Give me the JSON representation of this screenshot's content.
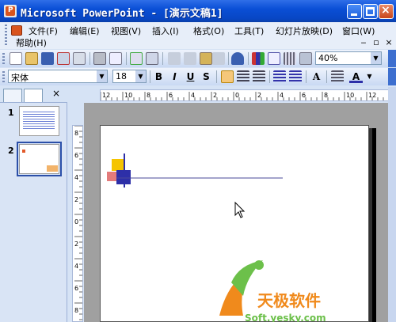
{
  "window": {
    "title": "Microsoft PowerPoint - [演示文稿1]",
    "app_icon_letter": "P"
  },
  "menu": {
    "items": [
      {
        "label": "文件(F)"
      },
      {
        "label": "编辑(E)"
      },
      {
        "label": "视图(V)"
      },
      {
        "label": "插入(I)"
      },
      {
        "label": "格式(O)"
      },
      {
        "label": "工具(T)"
      },
      {
        "label": "幻灯片放映(D)"
      },
      {
        "label": "窗口(W)"
      },
      {
        "label": "帮助(H)"
      }
    ],
    "mdi_controls": [
      "‒",
      "▫",
      "×"
    ]
  },
  "toolbar_standard": {
    "zoom": "40%"
  },
  "toolbar_format": {
    "font": "宋体",
    "size": "18",
    "bold": "B",
    "italic": "I",
    "underline": "U",
    "shadow": "S",
    "grow_font": "A",
    "font_color": "A"
  },
  "slides_panel": {
    "tab_close": "×",
    "slide_numbers": [
      "1",
      "2"
    ]
  },
  "watermark": {
    "name": "天极软件",
    "url": "Soft.yesky.com"
  },
  "colors": {
    "title_bar": "#0a4fd6",
    "panel_bg": "#d6e3f5",
    "workarea": "#a0a0a0",
    "accent_yellow": "#f5c400",
    "accent_blue": "#2d2fa8",
    "accent_red": "#d94f4f",
    "watermark_orange": "#f08a1c",
    "watermark_green": "#6cc04a"
  },
  "icons": [
    "powerpoint-app-icon",
    "minimize-icon",
    "maximize-icon",
    "close-icon",
    "new-icon",
    "open-icon",
    "save-icon",
    "permission-icon",
    "email-icon",
    "print-icon",
    "print-preview-icon",
    "spelling-icon",
    "research-icon",
    "cut-icon",
    "copy-icon",
    "paste-icon",
    "format-painter-icon",
    "undo-icon",
    "chart-icon",
    "table-icon",
    "expand-all-icon",
    "grayscale-icon",
    "align-left-icon",
    "center-icon",
    "align-right-icon",
    "numbering-icon",
    "bullets-icon",
    "decrease-indent-icon",
    "mouse-cursor-icon"
  ]
}
